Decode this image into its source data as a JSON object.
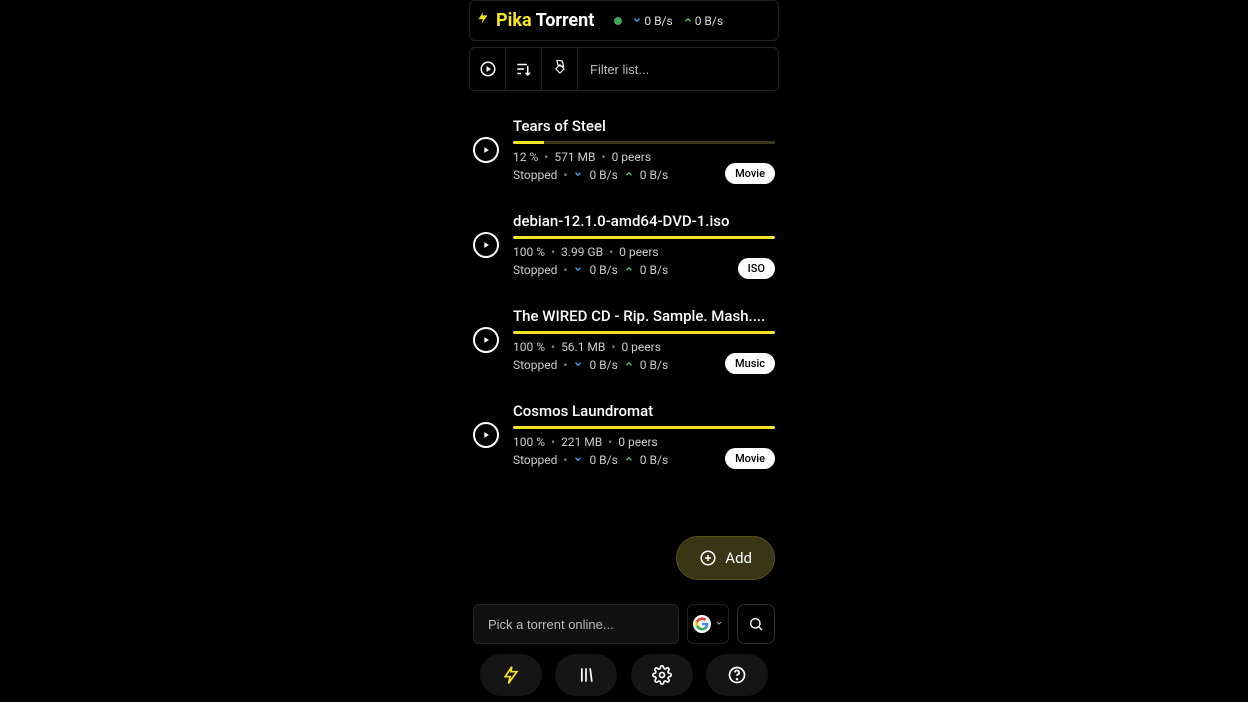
{
  "header": {
    "logo_part1": "Pika",
    "logo_part2": "Torrent",
    "status_color": "#3fa65a",
    "down_speed": "0 B/s",
    "up_speed": "0 B/s"
  },
  "toolbar": {
    "filter_placeholder": "Filter list..."
  },
  "torrents": [
    {
      "title": "Tears of Steel",
      "progress_pct": 12,
      "percent_label": "12 %",
      "size": "571 MB",
      "peers": "0 peers",
      "state": "Stopped",
      "down": "0 B/s",
      "up": "0 B/s",
      "tag": "Movie"
    },
    {
      "title": "debian-12.1.0-amd64-DVD-1.iso",
      "progress_pct": 100,
      "percent_label": "100 %",
      "size": "3.99 GB",
      "peers": "0 peers",
      "state": "Stopped",
      "down": "0 B/s",
      "up": "0 B/s",
      "tag": "ISO"
    },
    {
      "title": "The WIRED CD - Rip. Sample. Mash....",
      "progress_pct": 100,
      "percent_label": "100 %",
      "size": "56.1 MB",
      "peers": "0 peers",
      "state": "Stopped",
      "down": "0 B/s",
      "up": "0 B/s",
      "tag": "Music"
    },
    {
      "title": "Cosmos Laundromat",
      "progress_pct": 100,
      "percent_label": "100 %",
      "size": "221 MB",
      "peers": "0 peers",
      "state": "Stopped",
      "down": "0 B/s",
      "up": "0 B/s",
      "tag": "Movie"
    }
  ],
  "add_button": {
    "label": "Add"
  },
  "search": {
    "placeholder": "Pick a torrent online..."
  }
}
